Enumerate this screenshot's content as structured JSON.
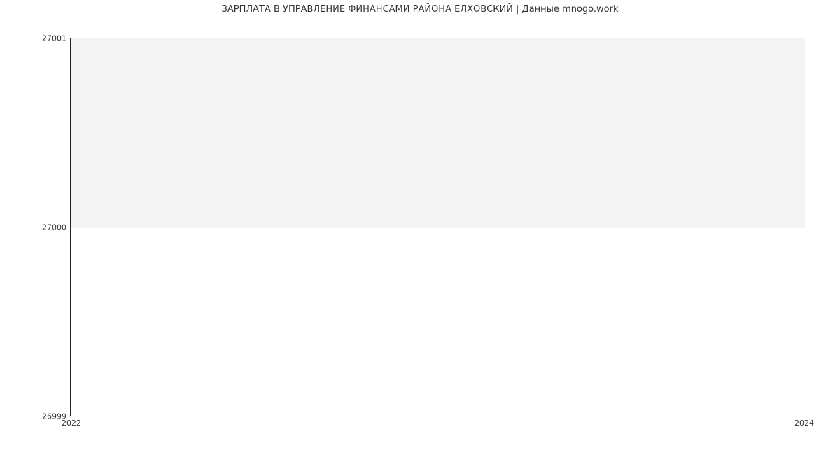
{
  "chart_data": {
    "type": "area",
    "title": "ЗАРПЛАТА В УПРАВЛЕНИЕ ФИНАНСАМИ РАЙОНА ЕЛХОВСКИЙ | Данные mnogo.work",
    "xlabel": "",
    "ylabel": "",
    "x": [
      2022,
      2024
    ],
    "values": [
      27000,
      27000
    ],
    "xlim": [
      2022,
      2024
    ],
    "ylim": [
      26999,
      27001
    ],
    "yticks": [
      26999,
      27000,
      27001
    ],
    "xticks": [
      2022,
      2024
    ]
  }
}
